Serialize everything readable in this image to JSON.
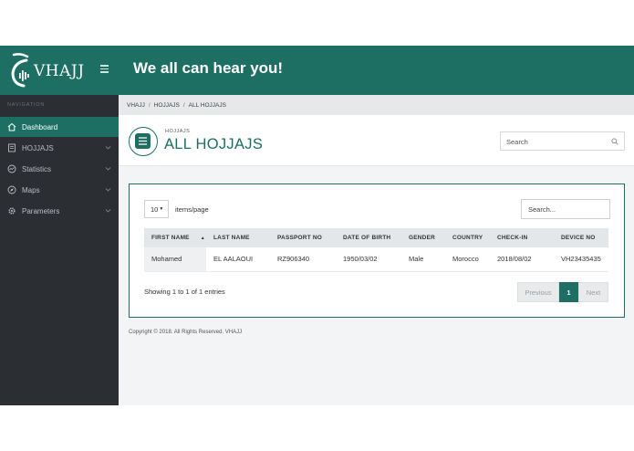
{
  "app": {
    "logo_text": "VHAJJ"
  },
  "sidebar": {
    "section_label": "NAVIGATION",
    "items": [
      {
        "label": "Dashboard",
        "icon": "home-icon"
      },
      {
        "label": "HOJJAJS",
        "icon": "file-icon"
      },
      {
        "label": "Statistics",
        "icon": "chart-icon"
      },
      {
        "label": "Maps",
        "icon": "compass-icon"
      },
      {
        "label": "Parameters",
        "icon": "gear-icon"
      }
    ]
  },
  "topbar": {
    "title": "We all can hear you!"
  },
  "breadcrumb": [
    "VHAJJ",
    "HOJJAJS",
    "ALL HOJJAJS"
  ],
  "page_header": {
    "subtitle": "HOJJAJS",
    "title": "ALL HOJJAJS",
    "search_placeholder": "Search"
  },
  "table_controls": {
    "per_page_value": "10",
    "per_page_label": "items/page",
    "search_placeholder": "Search..."
  },
  "table": {
    "columns": [
      "FIRST NAME",
      "LAST NAME",
      "PASSPORT NO",
      "DATE OF BIRTH",
      "GENDER",
      "COUNTRY",
      "CHECK-IN",
      "DEVICE NO"
    ],
    "rows": [
      [
        "Mohamed",
        "EL AALAOUI",
        "RZ906340",
        "1950/03/02",
        "Male",
        "Morocco",
        "2018/08/02",
        "VH23435435"
      ]
    ]
  },
  "entries_text": "Showing 1 to 1 of 1 entries",
  "pagination": {
    "prev": "Previous",
    "current": "1",
    "next": "Next"
  },
  "footer": "Copyright © 2018. All Rights Reserved. VHAJJ",
  "colors": {
    "brand": "#1d6f63",
    "sidebar": "#2b2e33"
  }
}
